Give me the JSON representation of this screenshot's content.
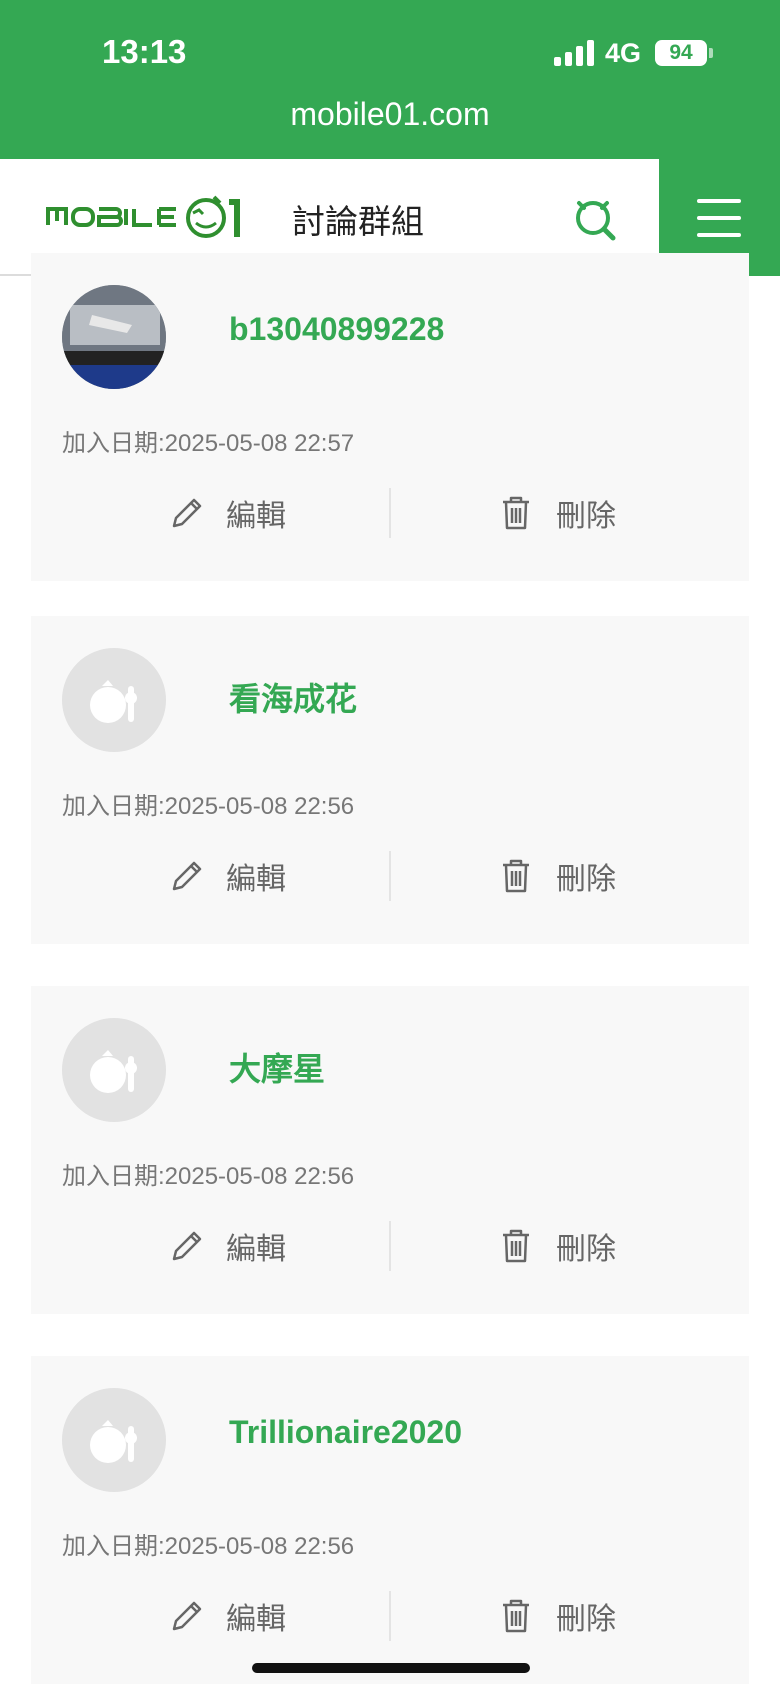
{
  "status_bar": {
    "time": "13:13",
    "network": "4G",
    "battery": "94"
  },
  "browser": {
    "url": "mobile01.com"
  },
  "header": {
    "logo_text": "MOBILE01",
    "title": "討論群組",
    "accent_color": "#34a853"
  },
  "members": [
    {
      "username": "b13040899228",
      "join_date": "加入日期:2025-05-08 22:57",
      "avatar": "photo",
      "edit_label": "編輯",
      "delete_label": "刪除"
    },
    {
      "username": "看海成花",
      "join_date": "加入日期:2025-05-08 22:56",
      "avatar": "default",
      "edit_label": "編輯",
      "delete_label": "刪除"
    },
    {
      "username": "大摩星",
      "join_date": "加入日期:2025-05-08 22:56",
      "avatar": "default",
      "edit_label": "編輯",
      "delete_label": "刪除"
    },
    {
      "username": "Trillionaire2020",
      "join_date": "加入日期:2025-05-08 22:56",
      "avatar": "default",
      "edit_label": "編輯",
      "delete_label": "刪除"
    }
  ]
}
